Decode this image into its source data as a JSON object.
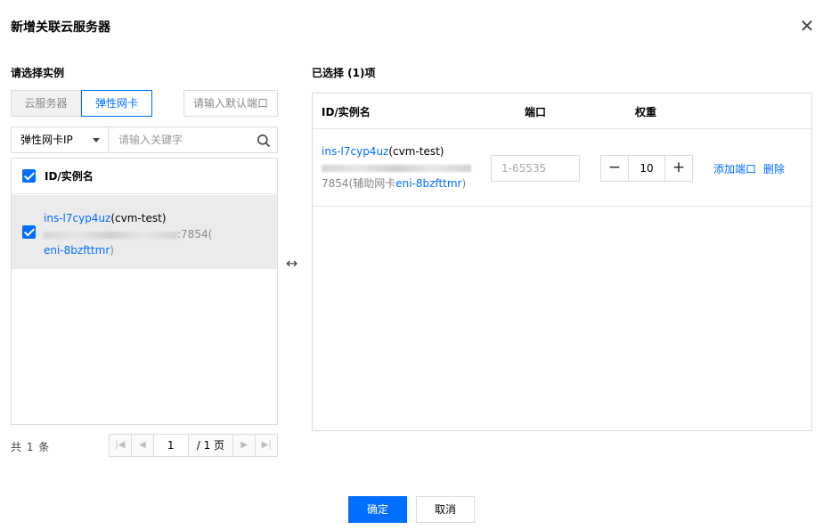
{
  "dialog": {
    "title": "新增关联云服务器",
    "close_icon": "close-icon"
  },
  "left": {
    "section_title": "请选择实例",
    "tabs": [
      {
        "label": "云服务器",
        "active": false
      },
      {
        "label": "弹性网卡",
        "active": true
      }
    ],
    "default_port_placeholder": "请输入默认端口",
    "filter_select": "弹性网卡IP",
    "search_placeholder": "请输入关键字",
    "list_header": "ID/实例名",
    "rows": [
      {
        "instance_id": "ins-l7cyp4uz",
        "instance_name": "(cvm-test)",
        "addr_suffix": ":7854(",
        "eni_id": "eni-8bzfttmr",
        "eni_close": ")",
        "checked": true
      }
    ],
    "total_text": "共 1 条",
    "pager": {
      "current": "1",
      "total": "/ 1 页"
    }
  },
  "right": {
    "section_title": "已选择 (1)项",
    "headers": {
      "instance": "ID/实例名",
      "port": "端口",
      "weight": "权重"
    },
    "rows": [
      {
        "instance_id": "ins-l7cyp4uz",
        "instance_name": "(cvm-test)",
        "addr_suffix": "7854(辅助网卡",
        "eni_id": "eni-8bzfttmr",
        "eni_close": ")",
        "port_placeholder": "1-65535",
        "weight": "10",
        "add_port": "添加端口",
        "delete": "删除"
      }
    ]
  },
  "footer": {
    "confirm": "确定",
    "cancel": "取消"
  },
  "colors": {
    "accent": "#006eff",
    "border": "#dcdcdc",
    "selected_row": "#ebebeb"
  }
}
